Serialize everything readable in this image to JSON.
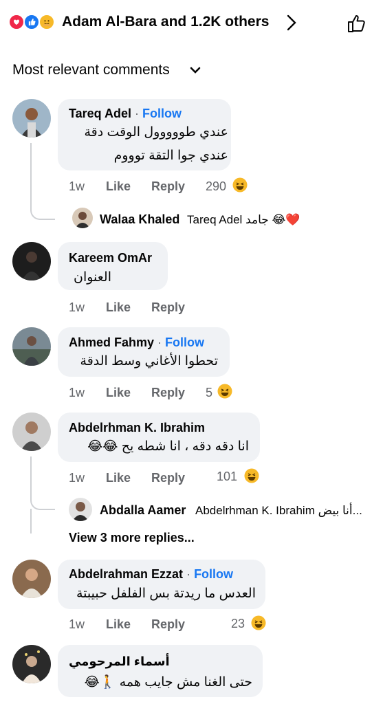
{
  "reactions": {
    "summary": "Adam Al-Bara and 1.2K others",
    "types": [
      "love",
      "like",
      "care"
    ]
  },
  "sort": {
    "label": "Most relevant comments"
  },
  "labels": {
    "like": "Like",
    "reply": "Reply",
    "follow": "Follow"
  },
  "comments": [
    {
      "author": "Tareq Adel",
      "follow": "Follow",
      "lines": [
        "عندي طووووول الوقت دقة",
        "عندي جوا التقة توووم"
      ],
      "time": "1w",
      "reaction_count": "290",
      "replies": [
        {
          "author": "Walaa Khaled",
          "text": "Tareq Adel جامد 😂❤️"
        }
      ]
    },
    {
      "author": "Kareem OmAr",
      "lines": [
        "العنوان"
      ],
      "time": "1w",
      "reaction_count": ""
    },
    {
      "author": "Ahmed Fahmy",
      "follow": "Follow",
      "lines": [
        "تحطوا الأغاني وسط الدقة"
      ],
      "time": "1w",
      "reaction_count": "5"
    },
    {
      "author": "Abdelrhman K. Ibrahim",
      "lines": [
        "انا دقه دقه ، انا شطه يح 😂😂"
      ],
      "time": "1w",
      "reaction_count": "101",
      "replies": [
        {
          "author": "Abdalla Aamer",
          "text": "Abdelrhman K. Ibrahim أنا بيض..."
        }
      ],
      "more_replies": "View 3 more replies..."
    },
    {
      "author": "Abdelrahman Ezzat",
      "follow": "Follow",
      "lines": [
        "العدس ما ريدتة بس الفلفل حبيبتة"
      ],
      "time": "1w",
      "reaction_count": "23"
    },
    {
      "author": "أسماء المرحومي",
      "lines": [
        "حتى الغنا مش جايب همه 🚶😂"
      ],
      "time": "",
      "reaction_count": ""
    }
  ],
  "colors": {
    "accent": "#1877f2",
    "bubble": "#f0f2f5",
    "muted": "#65676b",
    "thread": "#ced0d4"
  }
}
